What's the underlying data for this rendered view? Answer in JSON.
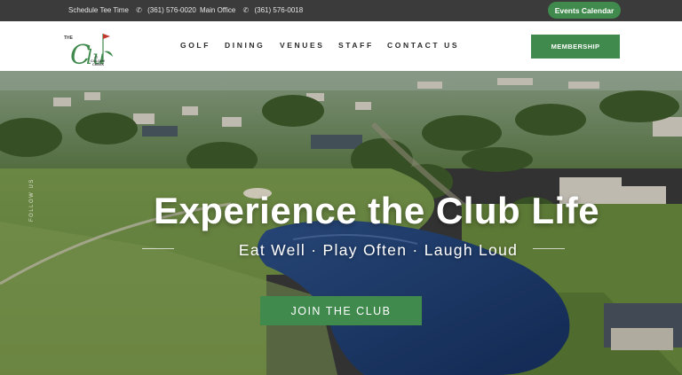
{
  "topbar": {
    "tee_time_label": "Schedule Tee Time",
    "tee_time_phone": "(361) 576-0020",
    "office_label": "Main Office",
    "office_phone": "(361) 576-0018",
    "events_button": "Events Calendar"
  },
  "header": {
    "logo_text": "THE Club AT COLONY CREEK",
    "nav": [
      "GOLF",
      "DINING",
      "VENUES",
      "STAFF",
      "CONTACT US"
    ],
    "membership_button": "MEMBERSHIP"
  },
  "hero": {
    "title": "Experience the Club Life",
    "subtitle": "Eat Well · Play Often · Laugh Loud",
    "cta": "JOIN THE CLUB",
    "follow_label": "FOLLOW US"
  },
  "colors": {
    "brand_green": "#3f8a4c",
    "topbar_bg": "#3b3b3b",
    "header_bg": "#ffffff"
  },
  "icons": [
    "phone-icon",
    "golf-flag-icon"
  ]
}
